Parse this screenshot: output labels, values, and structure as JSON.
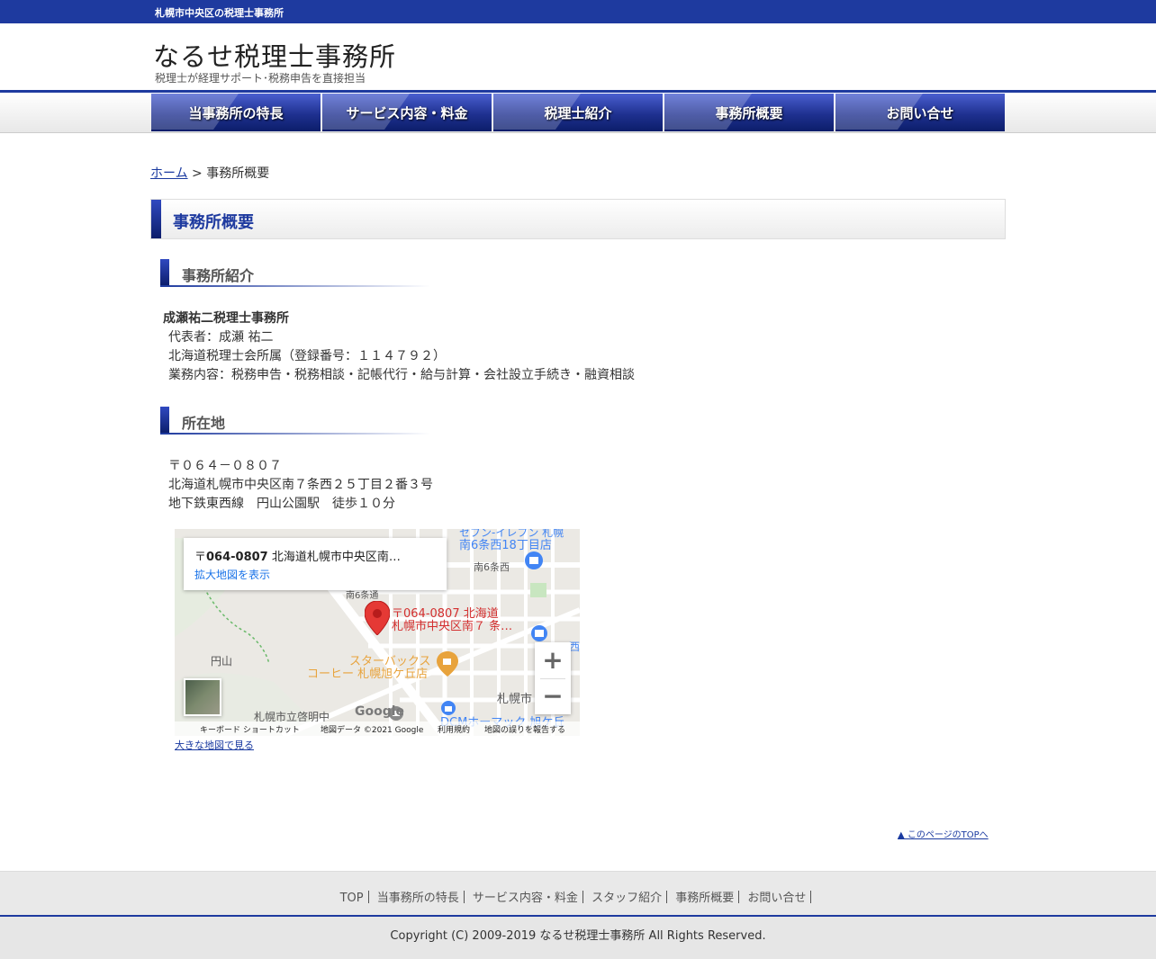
{
  "topbar": {
    "text": "札幌市中央区の税理士事務所"
  },
  "header": {
    "title": "なるせ税理士事務所",
    "subtitle": "税理士が経理サポート･税務申告を直接担当"
  },
  "nav": {
    "items": [
      {
        "label": "当事務所の特長"
      },
      {
        "label": "サービス内容・料金"
      },
      {
        "label": "税理士紹介"
      },
      {
        "label": "事務所概要"
      },
      {
        "label": "お問い合せ"
      }
    ]
  },
  "breadcrumb": {
    "home": "ホーム",
    "sep": ">",
    "current": "事務所概要"
  },
  "page": {
    "title": "事務所概要",
    "section1": {
      "heading": "事務所紹介",
      "name": "成瀬祐二税理士事務所",
      "lines": [
        "代表者：成瀬 祐二",
        "北海道税理士会所属（登録番号：１１４７９２）",
        "業務内容：税務申告・税務相談・記帳代行・給与計算・会社設立手続き・融資相談"
      ]
    },
    "section2": {
      "heading": "所在地",
      "lines": [
        "〒０６４－０８０７",
        "北海道札幌市中央区南７条西２５丁目２番３号",
        "地下鉄東西線　円山公園駅　徒歩１０分"
      ]
    }
  },
  "map": {
    "info_prefix": "〒",
    "info_zip": "064-0807",
    "info_rest": " 北海道札幌市中央区南…",
    "info_link": "拡大地図を表示",
    "pin_label_1": "〒064-0807 北海道",
    "pin_label_2": "札幌市中央区南７ 条…",
    "labels": {
      "store_top_1": "セブン-イレブン 札幌",
      "store_top_2": "南6条西18丁目店",
      "street": "南6条西",
      "street2": "南6条通",
      "area": "円山",
      "starbucks_1": "スターバックス",
      "starbucks_2": "コーヒー 札幌旭ケ丘店",
      "city": "札幌市",
      "school": "札幌市立啓明中",
      "dcm": "DCMホーマック 旭ケ丘",
      "west": "西"
    },
    "zoom_in": "+",
    "zoom_out": "−",
    "google": "Google",
    "footer": {
      "shortcut": "キーボード ショートカット",
      "data": "地図データ ©2021 Google",
      "terms": "利用規約",
      "report": "地図の誤りを報告する"
    },
    "big_link": "大きな地図で見る"
  },
  "totop": "▲ このページのTOPへ",
  "footer": {
    "links": [
      "TOP",
      "当事務所の特長",
      "サービス内容・料金",
      "スタッフ紹介",
      "事務所概要",
      "お問い合せ"
    ],
    "copyright": "Copyright (C) 2009-2019 なるせ税理士事務所 All Rights Reserved."
  },
  "colors": {
    "brand": "#1e3a9f",
    "link": "#1a3aa0",
    "pin": "#e53935",
    "poi": "#e8a33c",
    "store": "#4285f4"
  }
}
